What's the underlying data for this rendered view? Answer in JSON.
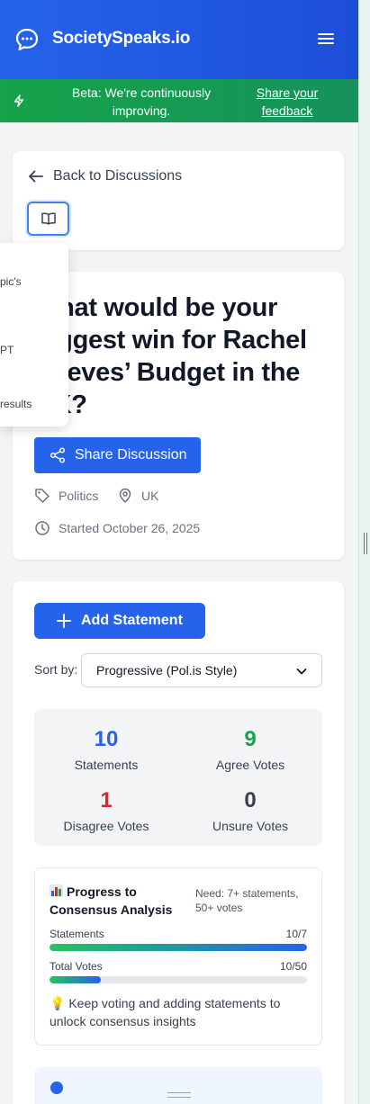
{
  "header": {
    "brand": "SocietySpeaks.io",
    "brand_color": "#2563eb"
  },
  "banner": {
    "message": "Beta: We're continuously improving.",
    "feedback_link": "Share your feedback",
    "color": "#16a34a"
  },
  "nav": {
    "back_label": "Back to Discussions"
  },
  "popout": {
    "items": [
      "pic's",
      "PT",
      "results"
    ]
  },
  "discussion": {
    "title": "What would be your biggest win for Rachel Reeves’ Budget in the UK?",
    "share_label": "Share Discussion",
    "topic": "Politics",
    "location": "UK",
    "started": "Started October 26, 2025"
  },
  "statements": {
    "add_label": "Add Statement",
    "sort_label": "Sort by:",
    "sort_value": "Progressive (Pol.is Style)"
  },
  "stats": [
    {
      "value": "10",
      "label": "Statements",
      "color": "#2563eb"
    },
    {
      "value": "9",
      "label": "Agree Votes",
      "color": "#16a34a"
    },
    {
      "value": "1",
      "label": "Disagree Votes",
      "color": "#dc2626"
    },
    {
      "value": "0",
      "label": "Unsure Votes",
      "color": "#374151"
    }
  ],
  "progress": {
    "title": "Progress to Consensus Analysis",
    "need": "Need: 7+ statements, 50+ votes",
    "rows": [
      {
        "label": "Statements",
        "value": "10/7",
        "fraction": 1.0
      },
      {
        "label": "Total Votes",
        "value": "10/50",
        "fraction": 0.2
      }
    ],
    "tip": "💡 Keep voting and adding statements to unlock consensus insights"
  }
}
